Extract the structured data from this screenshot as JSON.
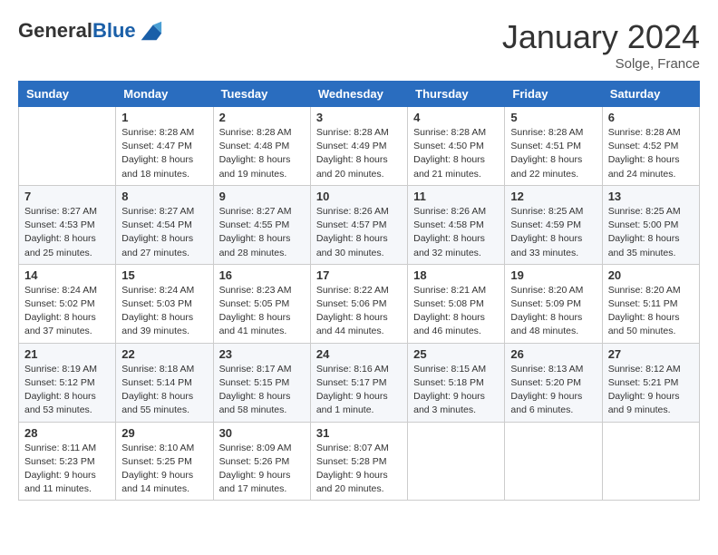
{
  "header": {
    "logo_general": "General",
    "logo_blue": "Blue",
    "month_title": "January 2024",
    "location": "Solge, France"
  },
  "calendar": {
    "days_of_week": [
      "Sunday",
      "Monday",
      "Tuesday",
      "Wednesday",
      "Thursday",
      "Friday",
      "Saturday"
    ],
    "weeks": [
      [
        {
          "day": "",
          "info": ""
        },
        {
          "day": "1",
          "info": "Sunrise: 8:28 AM\nSunset: 4:47 PM\nDaylight: 8 hours\nand 18 minutes."
        },
        {
          "day": "2",
          "info": "Sunrise: 8:28 AM\nSunset: 4:48 PM\nDaylight: 8 hours\nand 19 minutes."
        },
        {
          "day": "3",
          "info": "Sunrise: 8:28 AM\nSunset: 4:49 PM\nDaylight: 8 hours\nand 20 minutes."
        },
        {
          "day": "4",
          "info": "Sunrise: 8:28 AM\nSunset: 4:50 PM\nDaylight: 8 hours\nand 21 minutes."
        },
        {
          "day": "5",
          "info": "Sunrise: 8:28 AM\nSunset: 4:51 PM\nDaylight: 8 hours\nand 22 minutes."
        },
        {
          "day": "6",
          "info": "Sunrise: 8:28 AM\nSunset: 4:52 PM\nDaylight: 8 hours\nand 24 minutes."
        }
      ],
      [
        {
          "day": "7",
          "info": "Sunrise: 8:27 AM\nSunset: 4:53 PM\nDaylight: 8 hours\nand 25 minutes."
        },
        {
          "day": "8",
          "info": "Sunrise: 8:27 AM\nSunset: 4:54 PM\nDaylight: 8 hours\nand 27 minutes."
        },
        {
          "day": "9",
          "info": "Sunrise: 8:27 AM\nSunset: 4:55 PM\nDaylight: 8 hours\nand 28 minutes."
        },
        {
          "day": "10",
          "info": "Sunrise: 8:26 AM\nSunset: 4:57 PM\nDaylight: 8 hours\nand 30 minutes."
        },
        {
          "day": "11",
          "info": "Sunrise: 8:26 AM\nSunset: 4:58 PM\nDaylight: 8 hours\nand 32 minutes."
        },
        {
          "day": "12",
          "info": "Sunrise: 8:25 AM\nSunset: 4:59 PM\nDaylight: 8 hours\nand 33 minutes."
        },
        {
          "day": "13",
          "info": "Sunrise: 8:25 AM\nSunset: 5:00 PM\nDaylight: 8 hours\nand 35 minutes."
        }
      ],
      [
        {
          "day": "14",
          "info": "Sunrise: 8:24 AM\nSunset: 5:02 PM\nDaylight: 8 hours\nand 37 minutes."
        },
        {
          "day": "15",
          "info": "Sunrise: 8:24 AM\nSunset: 5:03 PM\nDaylight: 8 hours\nand 39 minutes."
        },
        {
          "day": "16",
          "info": "Sunrise: 8:23 AM\nSunset: 5:05 PM\nDaylight: 8 hours\nand 41 minutes."
        },
        {
          "day": "17",
          "info": "Sunrise: 8:22 AM\nSunset: 5:06 PM\nDaylight: 8 hours\nand 44 minutes."
        },
        {
          "day": "18",
          "info": "Sunrise: 8:21 AM\nSunset: 5:08 PM\nDaylight: 8 hours\nand 46 minutes."
        },
        {
          "day": "19",
          "info": "Sunrise: 8:20 AM\nSunset: 5:09 PM\nDaylight: 8 hours\nand 48 minutes."
        },
        {
          "day": "20",
          "info": "Sunrise: 8:20 AM\nSunset: 5:11 PM\nDaylight: 8 hours\nand 50 minutes."
        }
      ],
      [
        {
          "day": "21",
          "info": "Sunrise: 8:19 AM\nSunset: 5:12 PM\nDaylight: 8 hours\nand 53 minutes."
        },
        {
          "day": "22",
          "info": "Sunrise: 8:18 AM\nSunset: 5:14 PM\nDaylight: 8 hours\nand 55 minutes."
        },
        {
          "day": "23",
          "info": "Sunrise: 8:17 AM\nSunset: 5:15 PM\nDaylight: 8 hours\nand 58 minutes."
        },
        {
          "day": "24",
          "info": "Sunrise: 8:16 AM\nSunset: 5:17 PM\nDaylight: 9 hours\nand 1 minute."
        },
        {
          "day": "25",
          "info": "Sunrise: 8:15 AM\nSunset: 5:18 PM\nDaylight: 9 hours\nand 3 minutes."
        },
        {
          "day": "26",
          "info": "Sunrise: 8:13 AM\nSunset: 5:20 PM\nDaylight: 9 hours\nand 6 minutes."
        },
        {
          "day": "27",
          "info": "Sunrise: 8:12 AM\nSunset: 5:21 PM\nDaylight: 9 hours\nand 9 minutes."
        }
      ],
      [
        {
          "day": "28",
          "info": "Sunrise: 8:11 AM\nSunset: 5:23 PM\nDaylight: 9 hours\nand 11 minutes."
        },
        {
          "day": "29",
          "info": "Sunrise: 8:10 AM\nSunset: 5:25 PM\nDaylight: 9 hours\nand 14 minutes."
        },
        {
          "day": "30",
          "info": "Sunrise: 8:09 AM\nSunset: 5:26 PM\nDaylight: 9 hours\nand 17 minutes."
        },
        {
          "day": "31",
          "info": "Sunrise: 8:07 AM\nSunset: 5:28 PM\nDaylight: 9 hours\nand 20 minutes."
        },
        {
          "day": "",
          "info": ""
        },
        {
          "day": "",
          "info": ""
        },
        {
          "day": "",
          "info": ""
        }
      ]
    ]
  }
}
